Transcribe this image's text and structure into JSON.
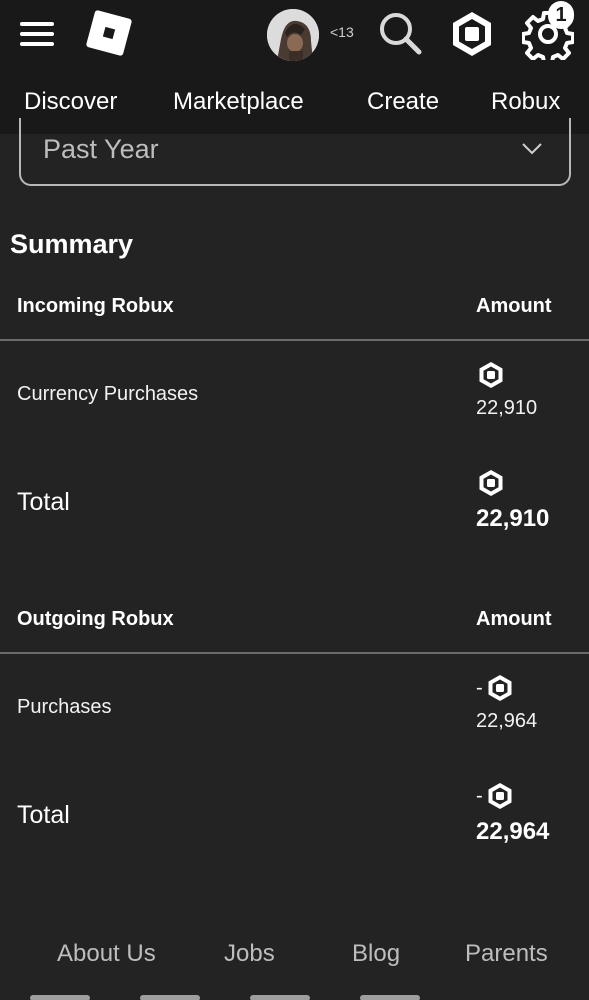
{
  "header": {
    "age_badge": "<13",
    "notification_count": "1"
  },
  "nav": {
    "items": [
      "Discover",
      "Marketplace",
      "Create",
      "Robux"
    ]
  },
  "filter": {
    "period": "Past Year"
  },
  "summary": {
    "title": "Summary",
    "incoming": {
      "header": "Incoming Robux",
      "amount_header": "Amount",
      "rows": [
        {
          "label": "Currency Purchases",
          "amount": "22,910"
        }
      ],
      "total_label": "Total",
      "total_amount": "22,910"
    },
    "outgoing": {
      "header": "Outgoing Robux",
      "amount_header": "Amount",
      "rows": [
        {
          "label": "Purchases",
          "sign": "-",
          "amount": "22,964"
        }
      ],
      "total_label": "Total",
      "total_sign": "-",
      "total_amount": "22,964"
    }
  },
  "footer": {
    "links": [
      "About Us",
      "Jobs",
      "Blog",
      "Parents"
    ]
  },
  "colors": {
    "background": "#232323",
    "header_background": "#191919",
    "divider": "#6b6b6b",
    "muted_text": "#bdbdbd"
  },
  "icons": {
    "menu": "hamburger-menu-icon",
    "logo": "roblox-logo-icon",
    "search": "search-icon",
    "robux": "robux-icon",
    "settings": "gear-icon",
    "dropdown": "chevron-down-icon"
  }
}
